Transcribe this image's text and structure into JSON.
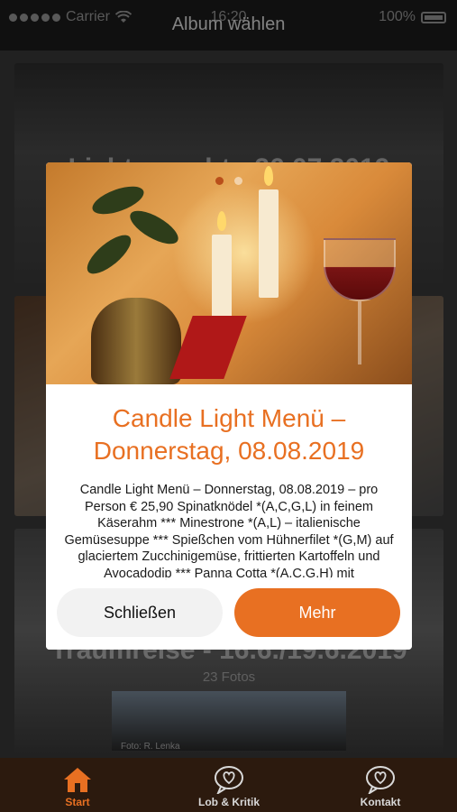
{
  "status_bar": {
    "carrier": "Carrier",
    "time": "16:20",
    "battery": "100%"
  },
  "nav": {
    "title": "Album wählen"
  },
  "albums": [
    {
      "title": "Lichternacht - 26.07.2019",
      "count": ""
    },
    {
      "title": "",
      "count": ""
    },
    {
      "title": "Traumreise - 16.6./19.6.2019",
      "count": "23 Fotos",
      "credit": "Foto: R. Lenka"
    }
  ],
  "modal": {
    "title": "Candle Light Menü – Donnerstag, 08.08.2019",
    "description": "Candle Light Menü – Donnerstag, 08.08.2019 – pro Person € 25,90 Spinatknödel *(A,C,G,L) in feinem Käserahm *** Minestrone *(A,L) – italienische Gemüsesuppe *** Spießchen vom Hühnerfilet *(G,M) auf glaciertem Zucchinigemüse, frittierten Kartoffeln und Avocadodip *** Panna Cotta *(A.C.G.H) mit",
    "close_label": "Schließen",
    "more_label": "Mehr",
    "accent_color": "#e87022"
  },
  "tabs": [
    {
      "label": "Start",
      "icon": "home-icon",
      "active": true
    },
    {
      "label": "Lob & Kritik",
      "icon": "heart-bubble-icon",
      "active": false
    },
    {
      "label": "Kontakt",
      "icon": "heart-bubble-icon",
      "active": false
    }
  ]
}
